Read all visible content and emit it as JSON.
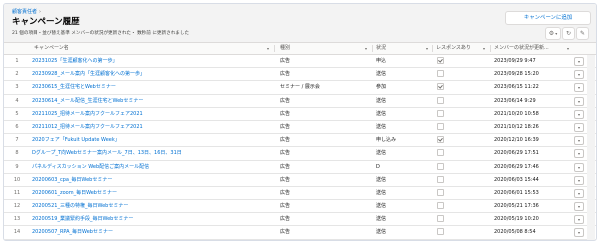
{
  "breadcrumb": {
    "label": "顧客責任者"
  },
  "page": {
    "title": "キャンペーン履歴",
    "subtitle": "21 個の項目・並び替え基準 メンバーの状況が更新された・ 数秒前 に更新されました",
    "add_button": "キャンペーンに追加"
  },
  "toolbar": {
    "settings": "⚙",
    "refresh": "↻",
    "edit": "✎"
  },
  "columns": [
    "キャンペーン名",
    "種別",
    "状況",
    "レスポンスあり",
    "メンバーの状況が更新..."
  ],
  "rows": [
    {
      "num": "1",
      "name": "20231025「生涯顧客化への第一歩」",
      "type": "広告",
      "status": "申込",
      "responded": true,
      "date": "2023/09/29 9:47"
    },
    {
      "num": "2",
      "name": "20230928_メール案内「生涯顧客化への第一歩」",
      "type": "広告",
      "status": "送信",
      "responded": false,
      "date": "2023/09/28 15:20"
    },
    {
      "num": "3",
      "name": "20230615_生涯住宅とWebセミナー",
      "type": "セミナー / 展示会",
      "status": "参加",
      "responded": true,
      "date": "2023/06/15 11:22"
    },
    {
      "num": "4",
      "name": "20230614_メール配信_生涯住宅とWebセミナー",
      "type": "広告",
      "status": "送信",
      "responded": false,
      "date": "2023/06/14 9:29"
    },
    {
      "num": "5",
      "name": "20211025_招待メール案内フクールフェア2021",
      "type": "広告",
      "status": "送信",
      "responded": false,
      "date": "2021/10/20 10:58"
    },
    {
      "num": "6",
      "name": "20211012_招待メール案内フクールフェア2021",
      "type": "広告",
      "status": "送信",
      "responded": false,
      "date": "2021/10/12 18:26"
    },
    {
      "num": "7",
      "name": "2020フェア「Fukuit Update Week」",
      "type": "広告",
      "status": "申し込み",
      "responded": true,
      "date": "2020/12/10 16:39"
    },
    {
      "num": "8",
      "name": "Dグループ_T向Webセミナー案内メール_7日、13日、16日、31日",
      "type": "広告",
      "status": "送信",
      "responded": false,
      "date": "2020/06/29 17:51"
    },
    {
      "num": "9",
      "name": "パネルディスカッション Web配信ご案内メール配信",
      "type": "広告",
      "status": "D",
      "responded": false,
      "date": "2020/06/29 17:46"
    },
    {
      "num": "10",
      "name": "20200603_cpa_毎日Webセミナー",
      "type": "広告",
      "status": "送信",
      "responded": false,
      "date": "2020/06/03 15:44"
    },
    {
      "num": "11",
      "name": "20200601_zoom_毎日Webセミナー",
      "type": "広告",
      "status": "送信",
      "responded": false,
      "date": "2020/06/01 15:53"
    },
    {
      "num": "12",
      "name": "20200521_三種の特権_毎日Webセミナー",
      "type": "広告",
      "status": "送信",
      "responded": false,
      "date": "2020/05/21 17:36"
    },
    {
      "num": "13",
      "name": "20200519_業議緊約手段_毎日Webセミナー",
      "type": "広告",
      "status": "送信",
      "responded": false,
      "date": "2020/05/19 10:20"
    },
    {
      "num": "14",
      "name": "20200507_RPA_毎日Webセミナー",
      "type": "広告",
      "status": "送信",
      "responded": false,
      "date": "2020/05/08 8:54"
    },
    {
      "num": "15",
      "name": "Webセミナーご案内メール配信",
      "type": "広告",
      "status": "送信",
      "responded": false,
      "date": "2020/03/25 18:04"
    }
  ]
}
